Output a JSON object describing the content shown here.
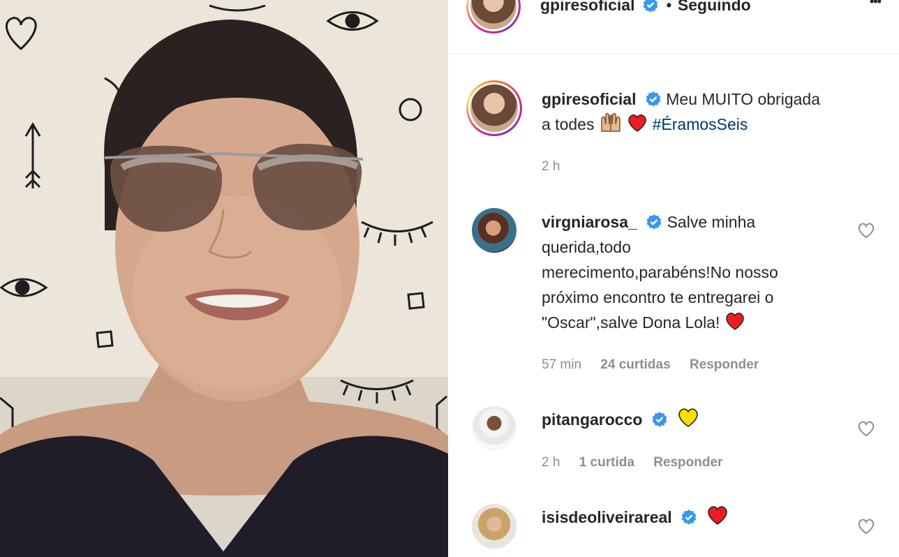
{
  "header": {
    "username": "gpiresoficial",
    "separator": "•",
    "follow_status": "Seguindo",
    "more_label": "•••"
  },
  "caption": {
    "username": "gpiresoficial",
    "text": "Meu MUITO obrigada",
    "text2": "a todes",
    "hashtag": "#ÉramosSeis",
    "time": "2 h"
  },
  "comments": [
    {
      "username": "virgniarosa_",
      "lines": [
        "Salve minha",
        "querida,todo",
        "merecimento,parabéns!No nosso",
        "próximo encontro te entregarei o",
        "\"Oscar\",salve Dona Lola!"
      ],
      "time": "57 min",
      "likes": "24 curtidas",
      "reply": "Responder"
    },
    {
      "username": "pitangarocco",
      "time": "2 h",
      "likes": "1 curtida",
      "reply": "Responder"
    },
    {
      "username": "isisdeoliveirareal"
    }
  ],
  "colors": {
    "verified": "#3897f0",
    "heart_red": "#ed1c24",
    "heart_yellow": "#ffde00",
    "muted": "#8e8e8e",
    "hashtag": "#00376b"
  }
}
